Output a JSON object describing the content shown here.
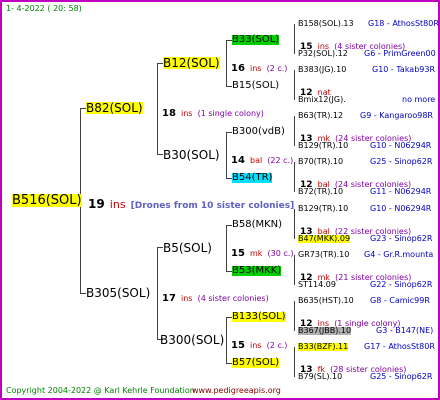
{
  "header": {
    "date_text": "1-   4-2022 ( 20: 58)"
  },
  "footer": {
    "copyright": "Copyright 2004-2022 @ Karl Kehrle Foundation",
    "url": "www.pedigreeapis.org"
  },
  "root": {
    "name": "B516(SOL)",
    "count": "19",
    "ins": "ins",
    "note": "[Drones from 10 sister colonies]"
  },
  "gen1": [
    {
      "name": "B82(SOL)",
      "count": "18",
      "ins": "ins",
      "note": "(1 single colony)"
    },
    {
      "name": "B305(SOL)",
      "count": "17",
      "ins": "ins",
      "note": "(4 sister colonies)"
    }
  ],
  "gen2": [
    {
      "name": "B12(SOL)",
      "count": "16",
      "ins": "ins",
      "note": "(2 c.)"
    },
    {
      "name": "B30(SOL)",
      "count": "14",
      "ins": "bal",
      "note": "(22 c.)"
    },
    {
      "name": "B5(SOL)",
      "count": "15",
      "ins": "mk",
      "note": "(30 c.)"
    },
    {
      "name": "B300(SOL)",
      "count": "15",
      "ins": "ins",
      "note": "(2 c.)"
    }
  ],
  "gen3": [
    {
      "name": "B33(SOL)",
      "count": "15",
      "ins": "ins",
      "note": "(4 sister colonies)"
    },
    {
      "name": "B15(SOL)",
      "count": "12",
      "ins": "nat",
      "note": ""
    },
    {
      "name": "B300(vdB)",
      "count": "13",
      "ins": "mk",
      "note": "(24 sister colonies)"
    },
    {
      "name": "B54(TR)",
      "count": "12",
      "ins": "bal",
      "note": "(24 sister colonies)"
    },
    {
      "name": "B58(MKN)",
      "count": "13",
      "ins": "bal",
      "note": "(22 sister colonies)"
    },
    {
      "name": "B53(MKK)",
      "count": "12",
      "ins": "mk",
      "note": "(21 sister colonies)"
    },
    {
      "name": "B133(SOL)",
      "count": "12",
      "ins": "ins",
      "note": "(1 single colony)"
    },
    {
      "name": "B57(SOL)",
      "count": "13",
      "ins": "fk",
      "note": "(28 sister colonies)"
    }
  ],
  "ancestors": [
    {
      "left": "B158(SOL).13",
      "right": "G18 - AthosSt80R"
    },
    {
      "left": "P32(SOL).12",
      "right": "G6 - PrimGreen00"
    },
    {
      "left": "B383(JG).10",
      "right": "G10 - Takab93R"
    },
    {
      "left": "Bmix12(JG).",
      "right": "no more"
    },
    {
      "left": "B63(TR).12",
      "right": "G9 - Kangaroo98R"
    },
    {
      "left": "B129(TR).10",
      "right": "G10 - N06294R"
    },
    {
      "left": "B70(TR).10",
      "right": "G25 - Sinop62R"
    },
    {
      "left": "B72(TR).10",
      "right": "G11 - N06294R"
    },
    {
      "left": "B129(TR).10",
      "right": "G10 - N06294R"
    },
    {
      "left": "B47(MKK).09",
      "right": "G23 - Sinop62R"
    },
    {
      "left": "GR73(TR).10",
      "right": "G4 - Gr.R.mounta"
    },
    {
      "left": "ST114.09",
      "right": "G22 - Sinop62R"
    },
    {
      "left": "B635(HST).10",
      "right": "G8 - Camic99R"
    },
    {
      "left": "B367(JBB).10",
      "right": "G3 - B147(NE)"
    },
    {
      "left": "B33(BZF).11",
      "right": "G17 - AthosSt80R"
    },
    {
      "left": "B79(SL).10",
      "right": "G25 - Sinop62R"
    }
  ],
  "colors": {
    "frame": "#c000c0",
    "highlight_yellow": "#ffff00",
    "highlight_green": "#00d000",
    "highlight_cyan": "#00e0ff",
    "highlight_gray": "#b0b0b0",
    "ins_red": "#c00000",
    "sisters_purple": "#8000a0",
    "info_blue": "#0000c0"
  }
}
